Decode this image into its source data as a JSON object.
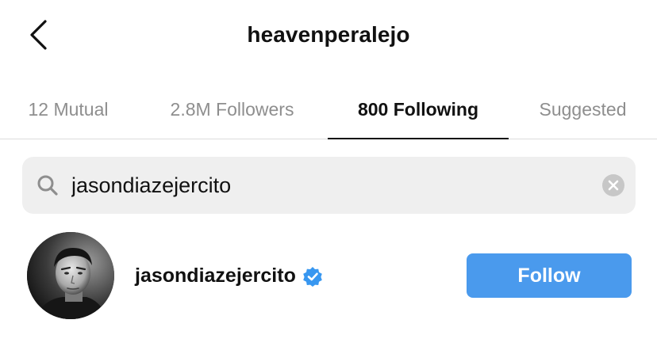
{
  "header": {
    "title": "heavenperalejo",
    "back_icon": "chevron-left-icon"
  },
  "tabs": [
    {
      "label": "12 Mutual",
      "active": false
    },
    {
      "label": "2.8M Followers",
      "active": false
    },
    {
      "label": "800 Following",
      "active": true
    },
    {
      "label": "Suggested",
      "active": false
    }
  ],
  "search": {
    "value": "jasondiazejercito",
    "placeholder": "Search",
    "icon": "search-icon",
    "clear_icon": "clear-icon"
  },
  "result": {
    "username": "jasondiazejercito",
    "verified": true,
    "follow_label": "Follow"
  },
  "colors": {
    "follow_button": "#4a9aed",
    "verified_badge": "#3897f0",
    "search_bg": "#efefef",
    "inactive_tab": "#8e8e8e"
  }
}
